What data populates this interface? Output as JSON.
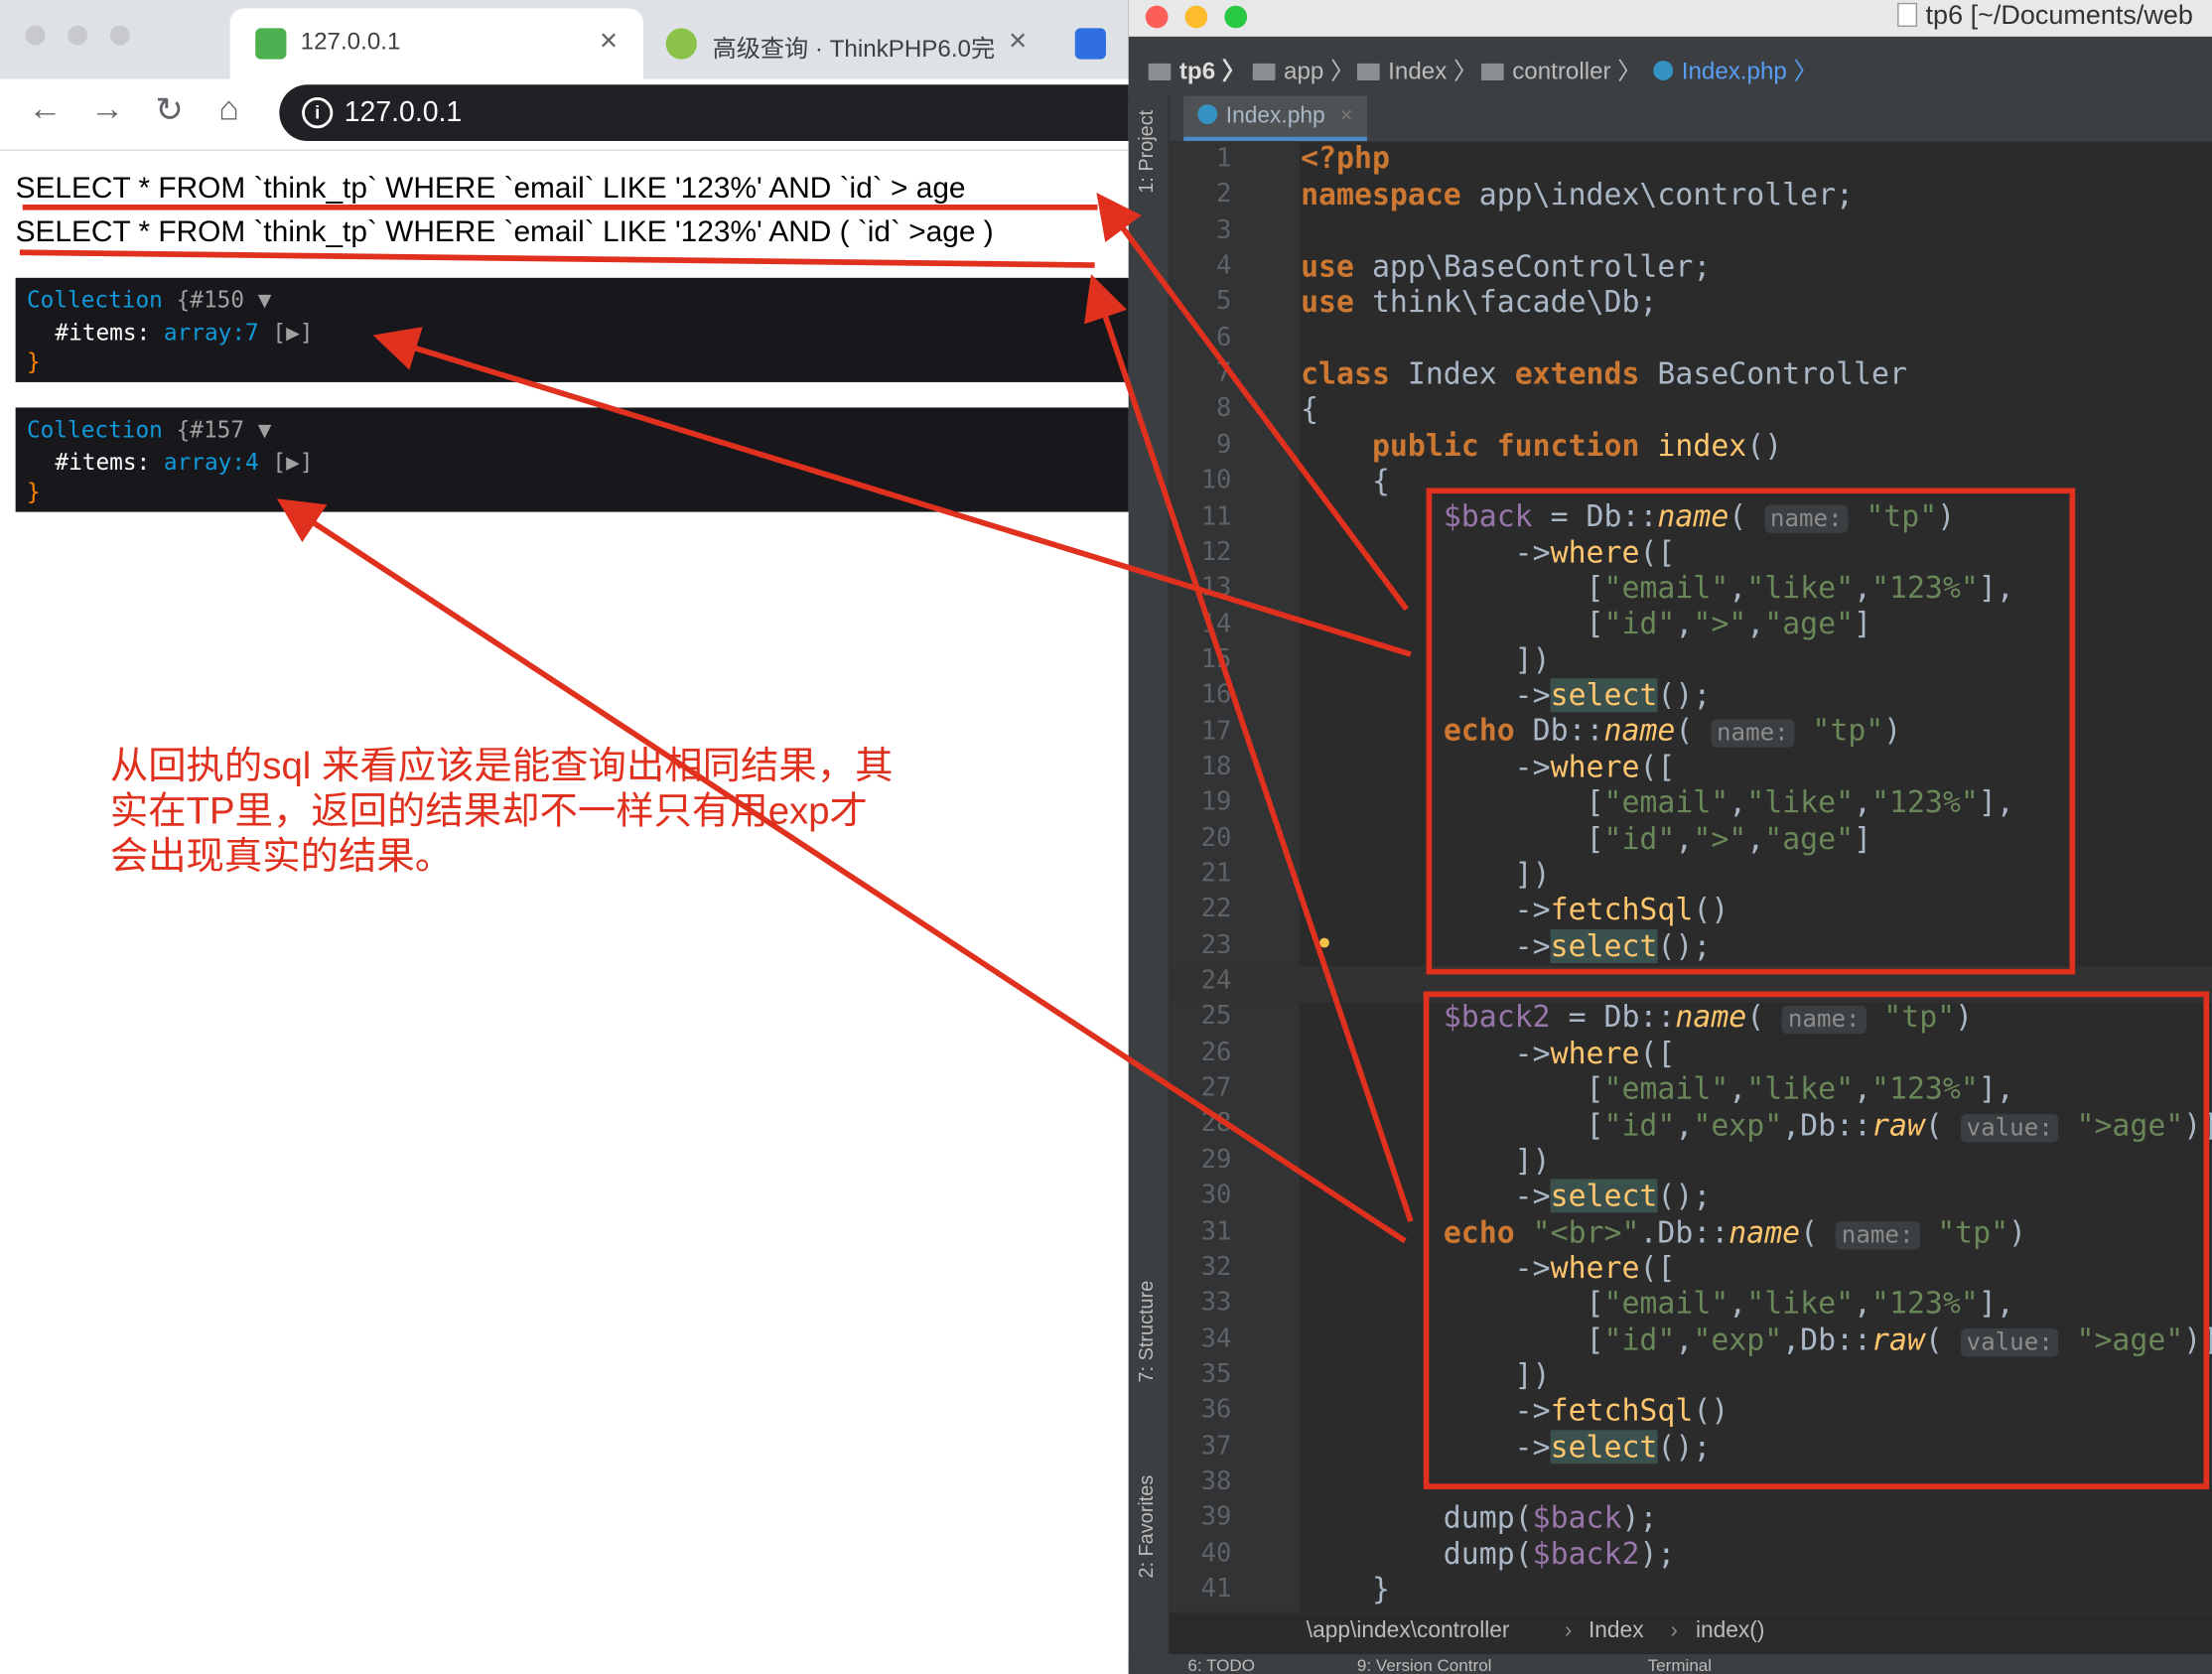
{
  "browser": {
    "tabs": [
      {
        "title": "127.0.0.1",
        "active": true
      },
      {
        "title": "高级查询 · ThinkPHP6.0完",
        "active": false
      }
    ],
    "url": "127.0.0.1",
    "sql_lines": [
      "SELECT * FROM `think_tp` WHERE `email` LIKE '123%' AND `id` > age",
      "SELECT * FROM `think_tp` WHERE `email` LIKE '123%' AND ( `id` >age )"
    ],
    "dumps": [
      {
        "head": "Collection",
        "ref": "{#150",
        "prop": "#items",
        "type": "array:7"
      },
      {
        "head": "Collection",
        "ref": "{#157",
        "prop": "#items",
        "type": "array:4"
      }
    ],
    "note": "从回执的sql 来看应该是能查询出相同结果，其实在TP里，返回的结果却不一样只有用exp才会出现真实的结果。"
  },
  "ide": {
    "title": "tp6 [~/Documents/web",
    "breadcrumbs": [
      "tp6",
      "app",
      "Index",
      "controller",
      "Index.php"
    ],
    "file_tab": "Index.php",
    "side_labels": {
      "project": "1: Project",
      "structure": "7: Structure",
      "favorites": "2: Favorites"
    },
    "line_numbers": [
      "1",
      "2",
      "3",
      "4",
      "5",
      "6",
      "7",
      "8",
      "9",
      "10",
      "11",
      "12",
      "13",
      "14",
      "15",
      "16",
      "17",
      "18",
      "19",
      "20",
      "21",
      "22",
      "23",
      "24",
      "25",
      "26",
      "27",
      "28",
      "29",
      "30",
      "31",
      "32",
      "33",
      "34",
      "35",
      "36",
      "37",
      "38",
      "39",
      "40",
      "41"
    ],
    "status_path": [
      "\\app\\index\\controller",
      "Index",
      "index()"
    ],
    "bottom_tabs": [
      "6: TODO",
      "9: Version Control",
      "Terminal"
    ]
  },
  "colors": {
    "annotation": "#e0301e",
    "ide_bg": "#2b2b2b",
    "keyword": "#cc7832",
    "string": "#6a8759"
  }
}
